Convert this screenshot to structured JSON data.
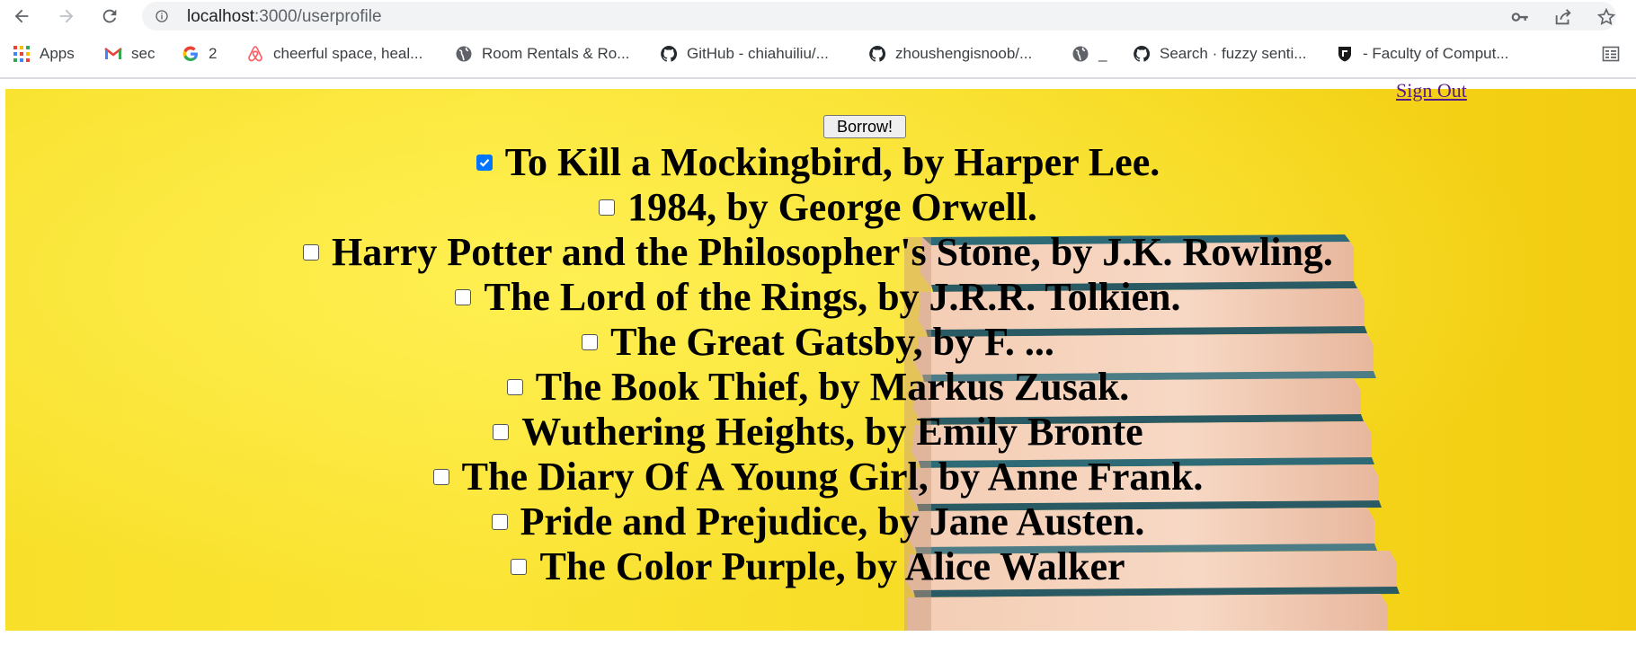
{
  "browser": {
    "url_host": "localhost",
    "url_rest": ":3000/userprofile"
  },
  "bookmarks": [
    {
      "label": "Apps"
    },
    {
      "label": "sec"
    },
    {
      "label": "2"
    },
    {
      "label": "cheerful space, heal..."
    },
    {
      "label": "Room Rentals & Ro..."
    },
    {
      "label": "GitHub - chiahuiliu/..."
    },
    {
      "label": "zhoushengisnoob/..."
    },
    {
      "label": "_"
    },
    {
      "label": "Search · fuzzy senti..."
    },
    {
      "label": "- Faculty of Comput..."
    }
  ],
  "page": {
    "signout_label": "Sign Out",
    "borrow_label": "Borrow!",
    "books": [
      {
        "title": "To Kill a Mockingbird, by Harper Lee.",
        "checked": true
      },
      {
        "title": "1984, by George Orwell.",
        "checked": false
      },
      {
        "title": "Harry Potter and the Philosopher's Stone, by J.K. Rowling.",
        "checked": false
      },
      {
        "title": "The Lord of the Rings, by J.R.R. Tolkien.",
        "checked": false
      },
      {
        "title": "The Great Gatsby, by F. ...",
        "checked": false
      },
      {
        "title": "The Book Thief, by Markus Zusak.",
        "checked": false
      },
      {
        "title": "Wuthering Heights, by Emily Bronte",
        "checked": false
      },
      {
        "title": "The Diary Of A Young Girl, by Anne Frank.",
        "checked": false
      },
      {
        "title": "Pride and Prejudice, by Jane Austen.",
        "checked": false
      },
      {
        "title": "The Color Purple, by Alice Walker",
        "checked": false
      }
    ]
  },
  "colors": {
    "checkbox_checked": "#0075ff",
    "background_yellow": "#f8e02a",
    "link_visited": "#551a8b"
  }
}
